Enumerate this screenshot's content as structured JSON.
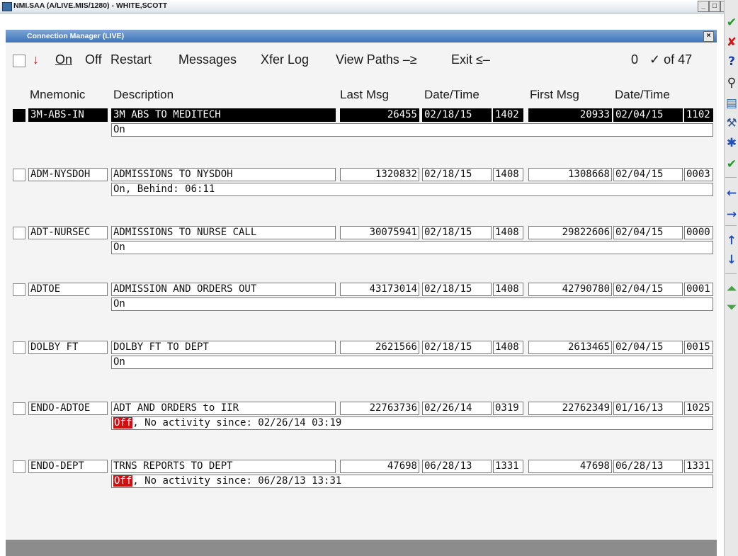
{
  "window": {
    "title": "NMI.SAA (A/LIVE.MIS/1280) - WHITE,SCOTT",
    "min": "_",
    "max": "□",
    "close": "×"
  },
  "dialog": {
    "title": "Connection Manager (LIVE)",
    "close": "×"
  },
  "menu": {
    "arrow": "↓",
    "on": "On",
    "off": "Off",
    "restart": "Restart",
    "messages": "Messages",
    "xfer_log": "Xfer Log",
    "view_paths": "View Paths –≥",
    "exit": "Exit ≤–",
    "count": "0",
    "count_of": "✓ of 47"
  },
  "columns": {
    "mnemonic": "Mnemonic",
    "description": "Description",
    "last_msg": "Last Msg",
    "last_date": "Date/Time",
    "first_msg": "First Msg",
    "first_date": "Date/Time"
  },
  "rows": [
    {
      "mnemonic": "3M-ABS-IN",
      "description": "3M ABS TO MEDITECH",
      "last_msg": "26455",
      "last_date": "02/18/15",
      "last_time": "1402",
      "first_msg": "20933",
      "first_date": "02/04/15",
      "first_time": "1102",
      "status": "On",
      "status_suffix": "",
      "selected": true
    },
    {
      "mnemonic": "ADM-NYSDOH",
      "description": "ADMISSIONS TO NYSDOH",
      "last_msg": "1320832",
      "last_date": "02/18/15",
      "last_time": "1408",
      "first_msg": "1308668",
      "first_date": "02/04/15",
      "first_time": "0003",
      "status": "On, Behind:  06:11",
      "status_suffix": "",
      "selected": false
    },
    {
      "mnemonic": "ADT-NURSEC",
      "description": "ADMISSIONS TO NURSE CALL",
      "last_msg": "30075941",
      "last_date": "02/18/15",
      "last_time": "1408",
      "first_msg": "29822606",
      "first_date": "02/04/15",
      "first_time": "0000",
      "status": "On",
      "status_suffix": "",
      "selected": false
    },
    {
      "mnemonic": "ADTOE",
      "description": "ADMISSION AND ORDERS OUT",
      "last_msg": "43173014",
      "last_date": "02/18/15",
      "last_time": "1408",
      "first_msg": "42790780",
      "first_date": "02/04/15",
      "first_time": "0001",
      "status": "On",
      "status_suffix": "",
      "selected": false
    },
    {
      "mnemonic": "DOLBY FT",
      "description": "DOLBY FT TO DEPT",
      "last_msg": "2621566",
      "last_date": "02/18/15",
      "last_time": "1408",
      "first_msg": "2613465",
      "first_date": "02/04/15",
      "first_time": "0015",
      "status": "On",
      "status_suffix": "",
      "selected": false
    },
    {
      "mnemonic": "ENDO-ADTOE",
      "description": "ADT AND ORDERS to IIR",
      "last_msg": "22763736",
      "last_date": "02/26/14",
      "last_time": "0319",
      "first_msg": "22762349",
      "first_date": "01/16/13",
      "first_time": "1025",
      "status": "Off",
      "status_suffix": ", No activity since: 02/26/14 03:19",
      "selected": false
    },
    {
      "mnemonic": "ENDO-DEPT",
      "description": "TRNS REPORTS TO DEPT",
      "last_msg": "47698",
      "last_date": "06/28/13",
      "last_time": "1331",
      "first_msg": "47698",
      "first_date": "06/28/13",
      "first_time": "1331",
      "status": "Off",
      "status_suffix": ", No activity since: 06/28/13 13:31",
      "selected": false
    }
  ],
  "toolbar": [
    {
      "icon": "check-icon",
      "glyph": "✔",
      "color": "#1f9a2a"
    },
    {
      "icon": "cancel-icon",
      "glyph": "✘",
      "color": "#d01818"
    },
    {
      "icon": "help-icon",
      "glyph": "?",
      "color": "#1a3fa8"
    },
    {
      "icon": "binoculars-icon",
      "glyph": "⚲",
      "color": "#222222"
    },
    {
      "icon": "notes-icon",
      "glyph": "▤",
      "color": "#2a6ab0"
    },
    {
      "icon": "tools-icon",
      "glyph": "⚒",
      "color": "#3a5a8a"
    },
    {
      "icon": "asterisk-icon",
      "glyph": "✱",
      "color": "#1f4fb8"
    },
    {
      "icon": "approve-icon",
      "glyph": "✔",
      "color": "#1f9a2a"
    },
    {
      "icon": "arrow-left-icon",
      "glyph": "←",
      "color": "#1f4fb8"
    },
    {
      "icon": "arrow-right-icon",
      "glyph": "→",
      "color": "#1f4fb8"
    },
    {
      "icon": "arrow-up-icon",
      "glyph": "↑",
      "color": "#1f4fb8"
    },
    {
      "icon": "arrow-down-icon",
      "glyph": "↓",
      "color": "#1f4fb8"
    },
    {
      "icon": "page-up-icon",
      "glyph": "⏶",
      "color": "#4aa04a"
    },
    {
      "icon": "page-down-icon",
      "glyph": "⏷",
      "color": "#4aa04a"
    }
  ]
}
